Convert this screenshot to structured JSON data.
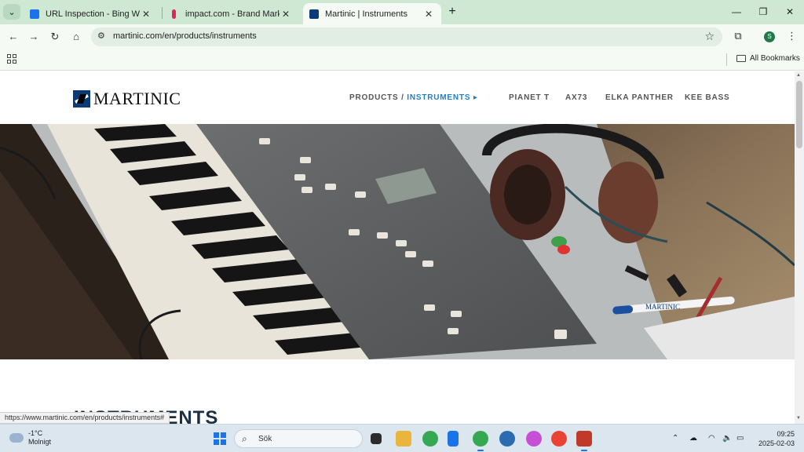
{
  "browser": {
    "tabs": [
      {
        "title": "URL Inspection - Bing Webmaster",
        "active": false,
        "favicon_color": "#1a73e8"
      },
      {
        "title": "impact.com - Brand Marketplace",
        "active": false,
        "favicon_color": "#e0245e"
      },
      {
        "title": "Martinic | Instruments",
        "active": true,
        "favicon_color": "#0b3a78"
      }
    ],
    "address": "martinic.com/en/products/instruments",
    "all_bookmarks": "All Bookmarks",
    "profile_initial": "S"
  },
  "site": {
    "logo_text": "MARTINIC",
    "breadcrumb": {
      "products": "PRODUCTS /",
      "instruments": "INSTRUMENTS ▸"
    },
    "nav": [
      "PIANET T",
      "AX73",
      "ELKA PANTHER",
      "KEE BASS"
    ],
    "hero_alt_lettering": "MARTINIC",
    "section_heading": "INSTRUMENTS"
  },
  "status_bar_url": "https://www.martinic.com/en/products/instruments#",
  "taskbar": {
    "weather_temp": "-1°C",
    "weather_desc": "Molnigt",
    "search_label": "Sök",
    "time": "09:25",
    "date": "2025-02-03"
  },
  "colors": {
    "tabstrip": "#cfe8d3",
    "toolbar": "#f5faf5",
    "nav_highlight": "#1d7fd1",
    "taskbar": "#dbe6ef"
  }
}
